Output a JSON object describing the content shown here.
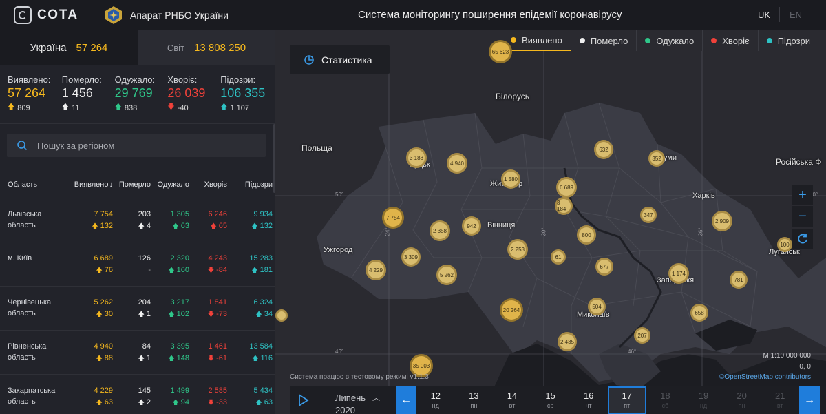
{
  "header": {
    "logo": "СОТА",
    "org": "Апарат РНБО України",
    "title": "Система моніторингу поширення епідемії коронавірусу",
    "lang_uk": "UK",
    "lang_en": "EN"
  },
  "tabs": {
    "ukraine": {
      "label": "Україна",
      "value": "57 264"
    },
    "world": {
      "label": "Світ",
      "value": "13 808 250"
    }
  },
  "summary": [
    {
      "label": "Виявлено:",
      "value": "57 264",
      "delta": "809",
      "dir": "up",
      "color": "#f5b81e"
    },
    {
      "label": "Померло:",
      "value": "1 456",
      "delta": "11",
      "dir": "up",
      "color": "#f0f0f0"
    },
    {
      "label": "Одужало:",
      "value": "29 769",
      "delta": "838",
      "dir": "up",
      "color": "#2fc78a"
    },
    {
      "label": "Хворіє:",
      "value": "26 039",
      "delta": "-40",
      "dir": "down",
      "color": "#f0413a"
    },
    {
      "label": "Підозри:",
      "value": "106 355",
      "delta": "1 107",
      "dir": "up",
      "color": "#2ec2c4"
    }
  ],
  "search": {
    "placeholder": "Пошук за регіоном"
  },
  "table": {
    "headers": {
      "region": "Область",
      "confirmed": "Виявлено",
      "deaths": "Померло",
      "recovered": "Одужало",
      "sick": "Хворіє",
      "suspected": "Підозри"
    },
    "rows": [
      {
        "region1": "Львівська",
        "region2": "область",
        "confirmed": "7 754",
        "confirmed_d": "132",
        "deaths": "203",
        "deaths_d": "4",
        "recovered": "1 305",
        "recovered_d": "63",
        "sick": "6 246",
        "sick_d": "65",
        "sick_dir": "up",
        "suspected": "9 934",
        "suspected_d": "132"
      },
      {
        "region1": "м. Київ",
        "region2": "",
        "confirmed": "6 689",
        "confirmed_d": "76",
        "deaths": "126",
        "deaths_d": "-",
        "recovered": "2 320",
        "recovered_d": "160",
        "sick": "4 243",
        "sick_d": "-84",
        "sick_dir": "down",
        "suspected": "15 283",
        "suspected_d": "181"
      },
      {
        "region1": "Чернівецька",
        "region2": "область",
        "confirmed": "5 262",
        "confirmed_d": "30",
        "deaths": "204",
        "deaths_d": "1",
        "recovered": "3 217",
        "recovered_d": "102",
        "sick": "1 841",
        "sick_d": "-73",
        "sick_dir": "down",
        "suspected": "6 324",
        "suspected_d": "34"
      },
      {
        "region1": "Рівненська",
        "region2": "область",
        "confirmed": "4 940",
        "confirmed_d": "88",
        "deaths": "84",
        "deaths_d": "1",
        "recovered": "3 395",
        "recovered_d": "148",
        "sick": "1 461",
        "sick_d": "-61",
        "sick_dir": "down",
        "suspected": "13 584",
        "suspected_d": "116"
      },
      {
        "region1": "Закарпатська",
        "region2": "область",
        "confirmed": "4 229",
        "confirmed_d": "63",
        "deaths": "145",
        "deaths_d": "2",
        "recovered": "1 499",
        "recovered_d": "94",
        "sick": "2 585",
        "sick_d": "-33",
        "sick_dir": "down",
        "suspected": "5 434",
        "suspected_d": "63"
      }
    ]
  },
  "map": {
    "stat_button": "Статистика",
    "legend": [
      {
        "label": "Виявлено",
        "color": "#f5b81e"
      },
      {
        "label": "Померло",
        "color": "#f0f0f0"
      },
      {
        "label": "Одужало",
        "color": "#2fc78a"
      },
      {
        "label": "Хворіє",
        "color": "#f0413a"
      },
      {
        "label": "Підозри",
        "color": "#2ec2c4"
      }
    ],
    "labels": {
      "belarus": "Білорусь",
      "poland": "Польща",
      "russia": "Російська Ф",
      "lutsk": "Луцьк",
      "zhytomyr": "Житомир",
      "sumy": "Суми",
      "vinnytsia": "Вінниця",
      "kharkiv": "Харків",
      "uzhhorod": "Ужгород",
      "zaporizhzhia": "Запоріжжя",
      "luhansk": "Луганськ",
      "mykolaiv": "Миколаїв",
      "lat50w": "50°",
      "lat50e": "50°",
      "lat46w": "46°",
      "lat46e": "46°",
      "lon24": "24°",
      "lon30": "30°",
      "lon36": "36°"
    },
    "clusters": [
      "65 623",
      "3 188",
      "4 940",
      "1 580",
      "6 689",
      "3 184",
      "632",
      "352",
      "7 754",
      "2 358",
      "942",
      "800",
      "347",
      "2 909",
      "100",
      "3 309",
      "2 253",
      "4 229",
      "5 262",
      "677",
      "1 174",
      "781",
      "20 264",
      "504",
      "658",
      "207",
      "2 435",
      "35 003",
      "61",
      ""
    ],
    "scale": "М 1:10 000 000",
    "coords": "0, 0",
    "note": "Система працює в тестовому режимі v1.1.3",
    "osm": "©OpenStreetMap contributors"
  },
  "timeline": {
    "month": "Липень",
    "year": "2020",
    "days": [
      {
        "d": "12",
        "w": "нд"
      },
      {
        "d": "13",
        "w": "пн"
      },
      {
        "d": "14",
        "w": "вт"
      },
      {
        "d": "15",
        "w": "ср"
      },
      {
        "d": "16",
        "w": "чт"
      },
      {
        "d": "17",
        "w": "пт"
      },
      {
        "d": "18",
        "w": "сб"
      },
      {
        "d": "19",
        "w": "нд"
      },
      {
        "d": "20",
        "w": "пн"
      },
      {
        "d": "21",
        "w": "вт"
      }
    ]
  }
}
